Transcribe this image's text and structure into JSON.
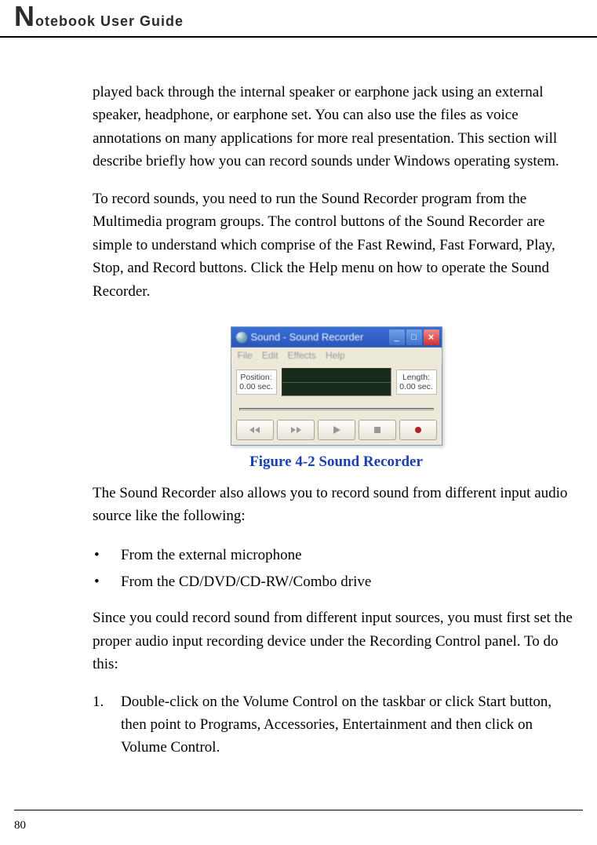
{
  "header": {
    "title_letter": "N",
    "title_rest": "otebook User Guide"
  },
  "paras": {
    "p1": "played back through the internal speaker or earphone jack using an external speaker, headphone, or earphone set. You can also use the files as voice annotations on many applications for more real presentation. This section will describe briefly how you can record sounds under Windows operating system.",
    "p2": "To record sounds, you need to run the Sound Recorder program from the Multimedia program groups. The control buttons of the Sound Recorder are simple to understand which comprise of the Fast Rewind, Fast Forward, Play, Stop, and Record buttons. Click the Help menu on how to operate the Sound Recorder.",
    "p3": "The Sound Recorder also allows you to record sound from different input audio source like the following:",
    "p4": "Since you could record sound from different input sources, you must first set the proper audio input recording device under the Recording Control panel. To do this:"
  },
  "bullets": [
    "From the external microphone",
    "From the CD/DVD/CD-RW/Combo drive"
  ],
  "steps": [
    {
      "n": "1.",
      "t": "Double-click on the Volume Control on the taskbar or click Start button, then point to Programs, Accessories, Entertainment and then click on Volume Control."
    }
  ],
  "figure": {
    "caption": "Figure 4-2    Sound Recorder",
    "window": {
      "title": "Sound - Sound Recorder",
      "menu": [
        "File",
        "Edit",
        "Effects",
        "Help"
      ],
      "position_label": "Position:",
      "position_value": "0.00 sec.",
      "length_label": "Length:",
      "length_value": "0.00 sec."
    }
  },
  "page_number": "80"
}
